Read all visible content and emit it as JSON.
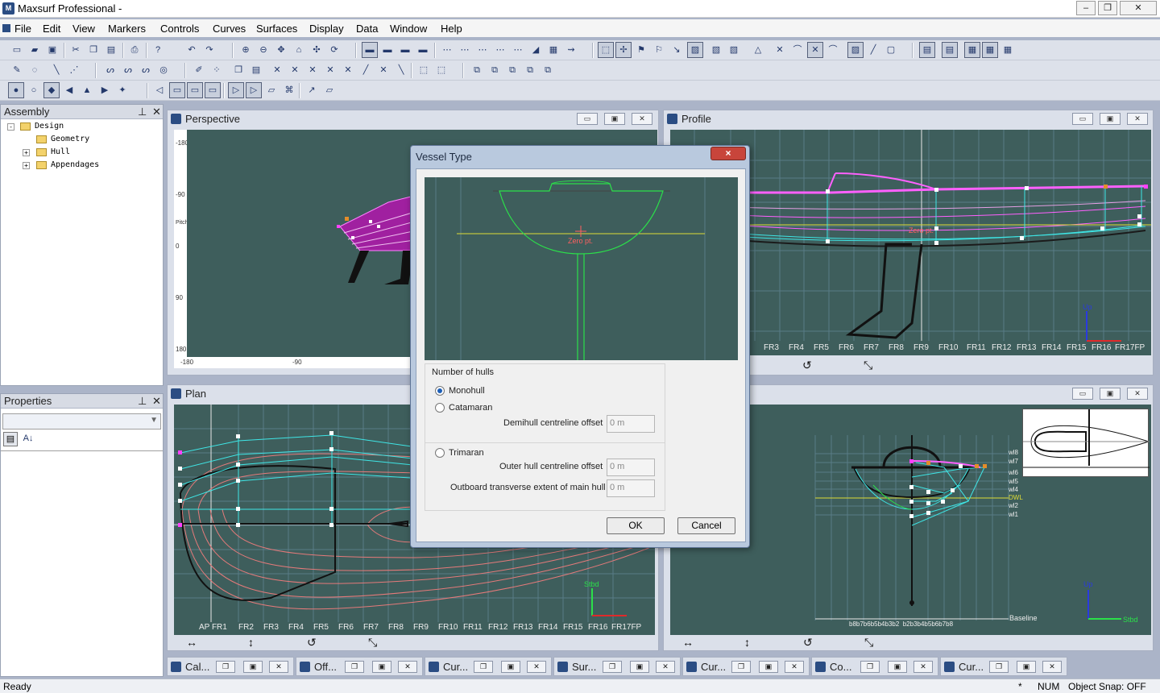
{
  "window": {
    "title": "Maxsurf Professional -"
  },
  "menu": [
    "File",
    "Edit",
    "View",
    "Markers",
    "Controls",
    "Curves",
    "Surfaces",
    "Display",
    "Data",
    "Window",
    "Help"
  ],
  "assembly": {
    "title": "Assembly",
    "tree": [
      {
        "label": "Design",
        "expand": "-"
      },
      {
        "label": "Geometry",
        "expand": ""
      },
      {
        "label": "Hull",
        "expand": "+"
      },
      {
        "label": "Appendages",
        "expand": "+"
      }
    ]
  },
  "properties": {
    "title": "Properties"
  },
  "viewports": {
    "perspective": {
      "title": "Perspective",
      "ruler_left": [
        "-180",
        "-90",
        "0",
        "90",
        "180"
      ],
      "ruler_bottom": [
        "-180",
        "-90"
      ],
      "pitch_label": "Pitch"
    },
    "profile": {
      "title": "Profile",
      "stations": [
        "FR3",
        "FR4",
        "FR5",
        "FR6",
        "FR7",
        "FR8",
        "FR9",
        "FR10",
        "FR11",
        "FR12",
        "FR13",
        "FR14",
        "FR15",
        "FR16",
        "FR17FP"
      ],
      "origin_label": "Zero pt.",
      "axis_label": "Up"
    },
    "plan": {
      "title": "Plan",
      "stations": [
        "AP FR1",
        "FR2",
        "FR3",
        "FR4",
        "FR5",
        "FR6",
        "FR7",
        "FR8",
        "FR9",
        "FR10",
        "FR11",
        "FR12",
        "FR13",
        "FR14",
        "FR15",
        "FR16",
        "FR17FP"
      ],
      "axis_label": "Stbd"
    },
    "bodyplan": {
      "title": "",
      "waterlines": [
        "wl8",
        "wl7",
        "wl6",
        "wl5",
        "wl4",
        "DWL",
        "wl2",
        "wl1"
      ],
      "baseline_label": "Baseline",
      "buttocks": "b8b7b6b5b4b3b2  b2b3b4b5b6b7b8",
      "axis_up": "Up",
      "axis_stbd": "Stbd"
    }
  },
  "minimized": [
    "Cal...",
    "Off...",
    "Cur...",
    "Sur...",
    "Cur...",
    "Co...",
    "Cur..."
  ],
  "status": {
    "left": "Ready",
    "star": "*",
    "num": "NUM",
    "snap": "Object Snap: OFF"
  },
  "dialog": {
    "title": "Vessel Type",
    "preview_label": "Zero pt.",
    "group_label": "Number of hulls",
    "monohull": "Monohull",
    "catamaran": "Catamaran",
    "demihull_label": "Demihull centreline offset",
    "demihull_value": "0 m",
    "trimaran": "Trimaran",
    "outer_label": "Outer hull centreline offset",
    "outer_value": "0 m",
    "outboard_label": "Outboard transverse extent of main hull",
    "outboard_value": "0 m",
    "ok": "OK",
    "cancel": "Cancel",
    "close": "×"
  }
}
